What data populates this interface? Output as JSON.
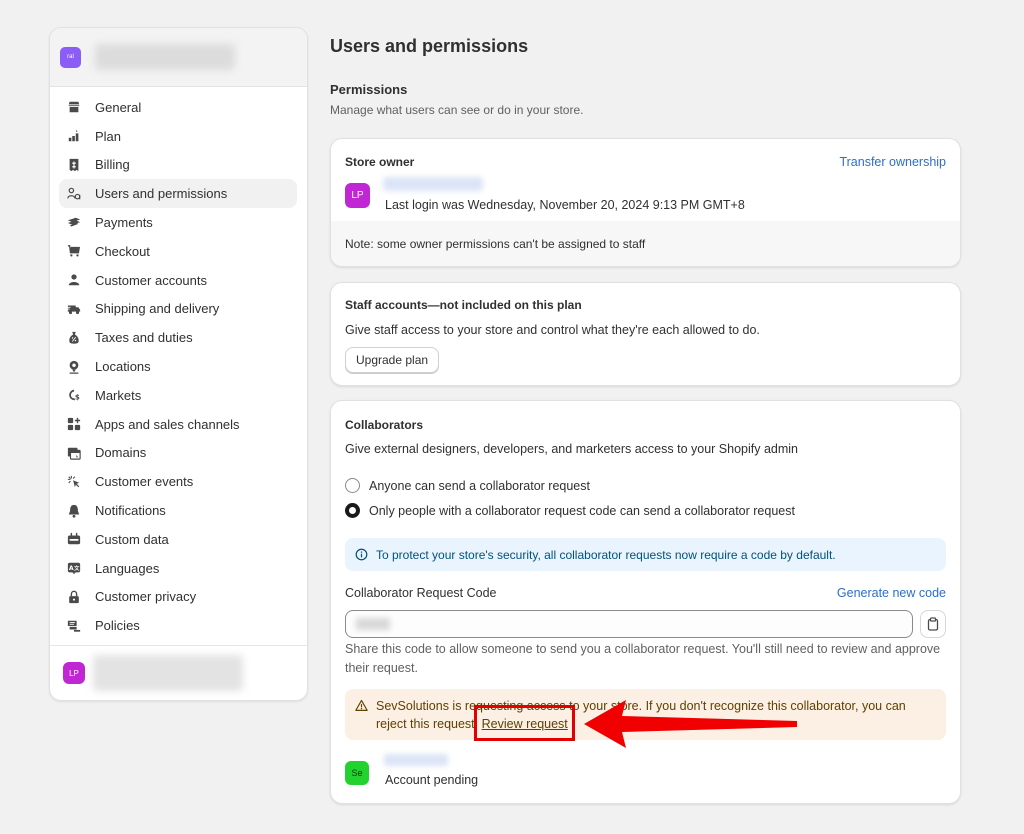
{
  "sidebar": {
    "store_avatar_initials": "ral",
    "items": [
      {
        "label": "General",
        "icon": "store-icon"
      },
      {
        "label": "Plan",
        "icon": "plan-icon"
      },
      {
        "label": "Billing",
        "icon": "receipt-dollar-icon"
      },
      {
        "label": "Users and permissions",
        "icon": "users-icon",
        "active": true
      },
      {
        "label": "Payments",
        "icon": "payments-icon"
      },
      {
        "label": "Checkout",
        "icon": "cart-icon"
      },
      {
        "label": "Customer accounts",
        "icon": "person-icon"
      },
      {
        "label": "Shipping and delivery",
        "icon": "truck-icon"
      },
      {
        "label": "Taxes and duties",
        "icon": "tax-bag-icon"
      },
      {
        "label": "Locations",
        "icon": "location-pin-icon"
      },
      {
        "label": "Markets",
        "icon": "globe-dollar-icon"
      },
      {
        "label": "Apps and sales channels",
        "icon": "apps-icon"
      },
      {
        "label": "Domains",
        "icon": "domains-icon"
      },
      {
        "label": "Customer events",
        "icon": "cursor-click-icon"
      },
      {
        "label": "Notifications",
        "icon": "bell-icon"
      },
      {
        "label": "Custom data",
        "icon": "custom-data-icon"
      },
      {
        "label": "Languages",
        "icon": "language-icon"
      },
      {
        "label": "Customer privacy",
        "icon": "lock-icon"
      },
      {
        "label": "Policies",
        "icon": "policies-icon"
      }
    ],
    "user_avatar_initials": "LP"
  },
  "main": {
    "page_title": "Users and permissions",
    "section_title": "Permissions",
    "section_desc": "Manage what users can see or do in your store.",
    "store_owner": {
      "title": "Store owner",
      "transfer_link": "Transfer ownership",
      "avatar_initials": "LP",
      "last_login": "Last login was Wednesday, November 20, 2024 9:13 PM GMT+8",
      "note": "Note: some owner permissions can't be assigned to staff"
    },
    "staff": {
      "title": "Staff accounts—not included on this plan",
      "desc": "Give staff access to your store and control what they're each allowed to do.",
      "upgrade_button": "Upgrade plan"
    },
    "collaborators": {
      "title": "Collaborators",
      "desc": "Give external designers, developers, and marketers access to your Shopify admin",
      "options": [
        {
          "label": "Anyone can send a collaborator request",
          "checked": false
        },
        {
          "label": "Only people with a collaborator request code can send a collaborator request",
          "checked": true
        }
      ],
      "info_banner": "To protect your store's security, all collaborator requests now require a code by default.",
      "code_label": "Collaborator Request Code",
      "generate_link": "Generate new code",
      "code_help": "Share this code to allow someone to send you a collaborator request. You'll still need to review and approve their request.",
      "warning_text": "SevSolutions is requesting access to your store. If you don't recognize this collaborator, you can reject this request.",
      "review_link": "Review request",
      "pending_avatar_initials": "Se",
      "pending_status": "Account pending"
    }
  },
  "colors": {
    "link": "#2c6ecb",
    "info_bg": "#eaf4ff",
    "warning_bg": "#fcefe3",
    "annotation": "#e30000"
  }
}
